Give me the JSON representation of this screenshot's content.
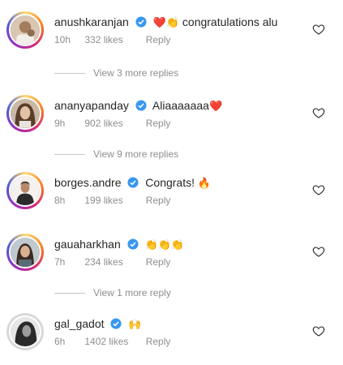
{
  "comments": [
    {
      "username": "anushkaranjan",
      "text": "congratulations alu",
      "emoji_prefix": "❤️👏",
      "emoji_suffix": "",
      "time": "10h",
      "likes": "332 likes",
      "reply": "Reply",
      "verified": true
    },
    {
      "username": "ananyapanday",
      "text": "Aliaaaaaaa",
      "emoji_prefix": "",
      "emoji_suffix": "❤️",
      "time": "9h",
      "likes": "902 likes",
      "reply": "Reply",
      "verified": true
    },
    {
      "username": "borges.andre",
      "text": "Congrats!",
      "emoji_prefix": "",
      "emoji_suffix": "🔥",
      "time": "8h",
      "likes": "199 likes",
      "reply": "Reply",
      "verified": true
    },
    {
      "username": "gauaharkhan",
      "text": "",
      "emoji_prefix": "👏👏👏",
      "emoji_suffix": "",
      "time": "7h",
      "likes": "234 likes",
      "reply": "Reply",
      "verified": true
    },
    {
      "username": "gal_gadot",
      "text": "",
      "emoji_prefix": "🙌",
      "emoji_suffix": "",
      "time": "6h",
      "likes": "1402 likes",
      "reply": "Reply",
      "verified": true
    }
  ],
  "view_replies": [
    {
      "label": "View 3 more replies"
    },
    {
      "label": "View 9 more replies"
    },
    {
      "label": "View 1 more reply"
    }
  ],
  "colors": {
    "verified": "#3897f0",
    "secondary_text": "#8e8e8e",
    "like_outline": "#262626",
    "heart_emoji": "#e0245e"
  },
  "icons": {
    "like": "heart-outline-icon",
    "verified": "verified-badge-icon"
  }
}
